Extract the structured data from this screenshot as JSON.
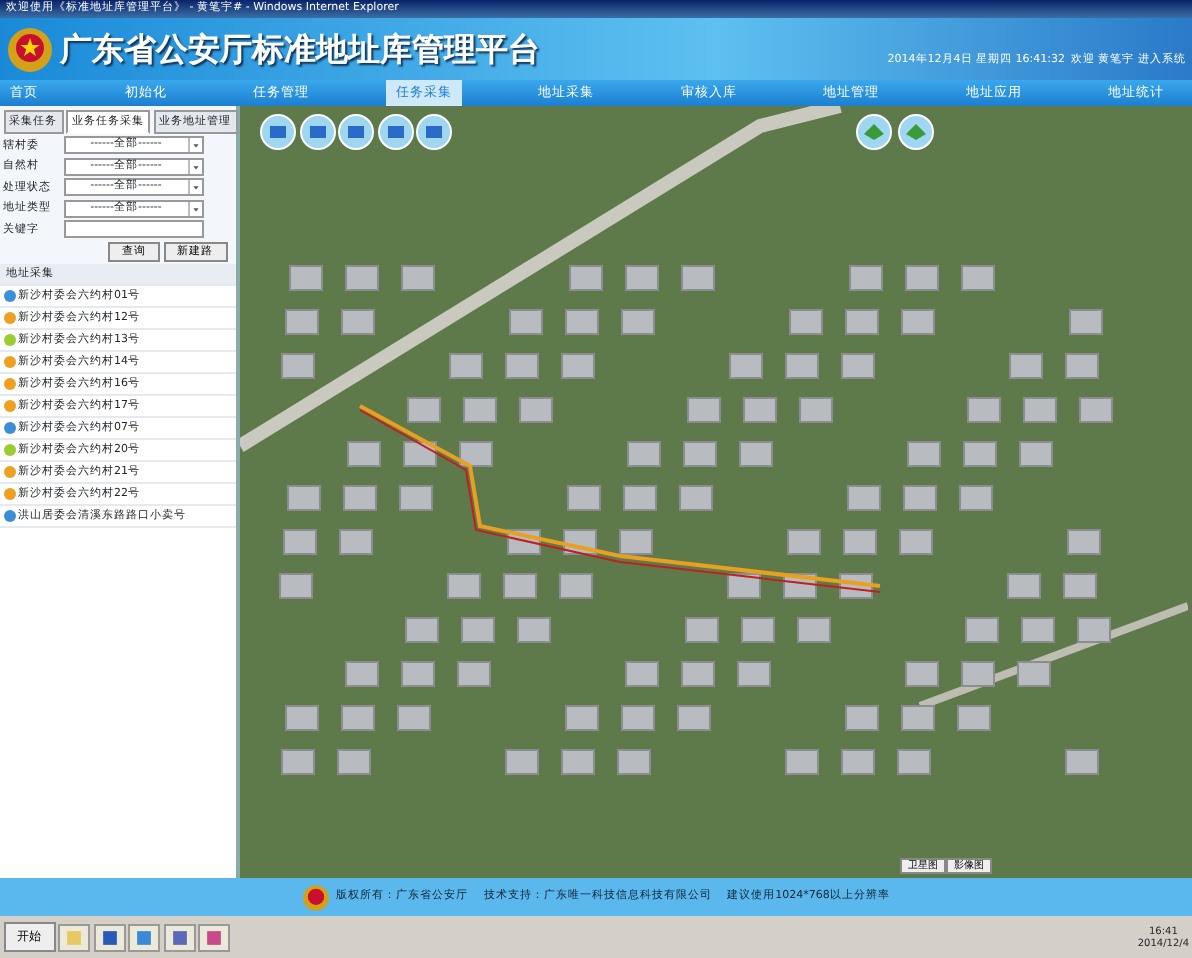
{
  "window": {
    "title": "欢迎使用《标准地址库管理平台》 - 黄笔宇# - Windows Internet Explorer"
  },
  "header": {
    "title": "广东省公安厅标准地址库管理平台",
    "datetime": "2014年12月4日 星期四 16:41:32",
    "welcome": "欢迎 黄笔宇 进入系统"
  },
  "nav": [
    {
      "label": "首页",
      "selected": false
    },
    {
      "label": "初始化",
      "selected": false
    },
    {
      "label": "任务管理",
      "selected": false
    },
    {
      "label": "任务采集",
      "selected": true
    },
    {
      "label": "地址采集",
      "selected": false
    },
    {
      "label": "审核入库",
      "selected": false
    },
    {
      "label": "地址管理",
      "selected": false
    },
    {
      "label": "地址应用",
      "selected": false
    },
    {
      "label": "地址统计",
      "selected": false
    }
  ],
  "side_tabs": [
    {
      "label": "采集任务",
      "selected": false
    },
    {
      "label": "业务任务采集",
      "selected": true
    },
    {
      "label": "业务地址管理",
      "selected": false
    }
  ],
  "filters": [
    {
      "label": "辖村委",
      "kind": "select",
      "value": "------全部------"
    },
    {
      "label": "自然村",
      "kind": "select",
      "value": "------全部------"
    },
    {
      "label": "处理状态",
      "kind": "select",
      "value": "------全部------"
    },
    {
      "label": "地址类型",
      "kind": "select",
      "value": "------全部------"
    },
    {
      "label": "关键字",
      "kind": "text"
    }
  ],
  "filter_buttons": [
    "查询",
    "新建路"
  ],
  "list": {
    "header": "地址采集",
    "items": [
      {
        "text": "新沙村委会六约村01号",
        "color": "#3a8fd8"
      },
      {
        "text": "新沙村委会六约村12号",
        "color": "#f0a020"
      },
      {
        "text": "新沙村委会六约村13号",
        "color": "#9acd32"
      },
      {
        "text": "新沙村委会六约村14号",
        "color": "#f0a020"
      },
      {
        "text": "新沙村委会六约村16号",
        "color": "#f0a020"
      },
      {
        "text": "新沙村委会六约村17号",
        "color": "#f0a020"
      },
      {
        "text": "新沙村委会六约村07号",
        "color": "#3a8fd8"
      },
      {
        "text": "新沙村委会六约村20号",
        "color": "#9acd32"
      },
      {
        "text": "新沙村委会六约村21号",
        "color": "#f0a020"
      },
      {
        "text": "新沙村委会六约村22号",
        "color": "#f0a020"
      },
      {
        "text": "洪山居委会清溪东路路口小卖号",
        "color": "#3a8fd8"
      }
    ]
  },
  "map": {
    "layer_buttons": [
      "卫星图",
      "影像图"
    ]
  },
  "footer": {
    "text": "版权所有：广东省公安厅　 技术支持：广东唯一科技信息科技有限公司　 建议使用1024*768以上分辨率"
  },
  "taskbar": {
    "start": "开始",
    "time": "16:41",
    "date": "2014/12/4"
  }
}
